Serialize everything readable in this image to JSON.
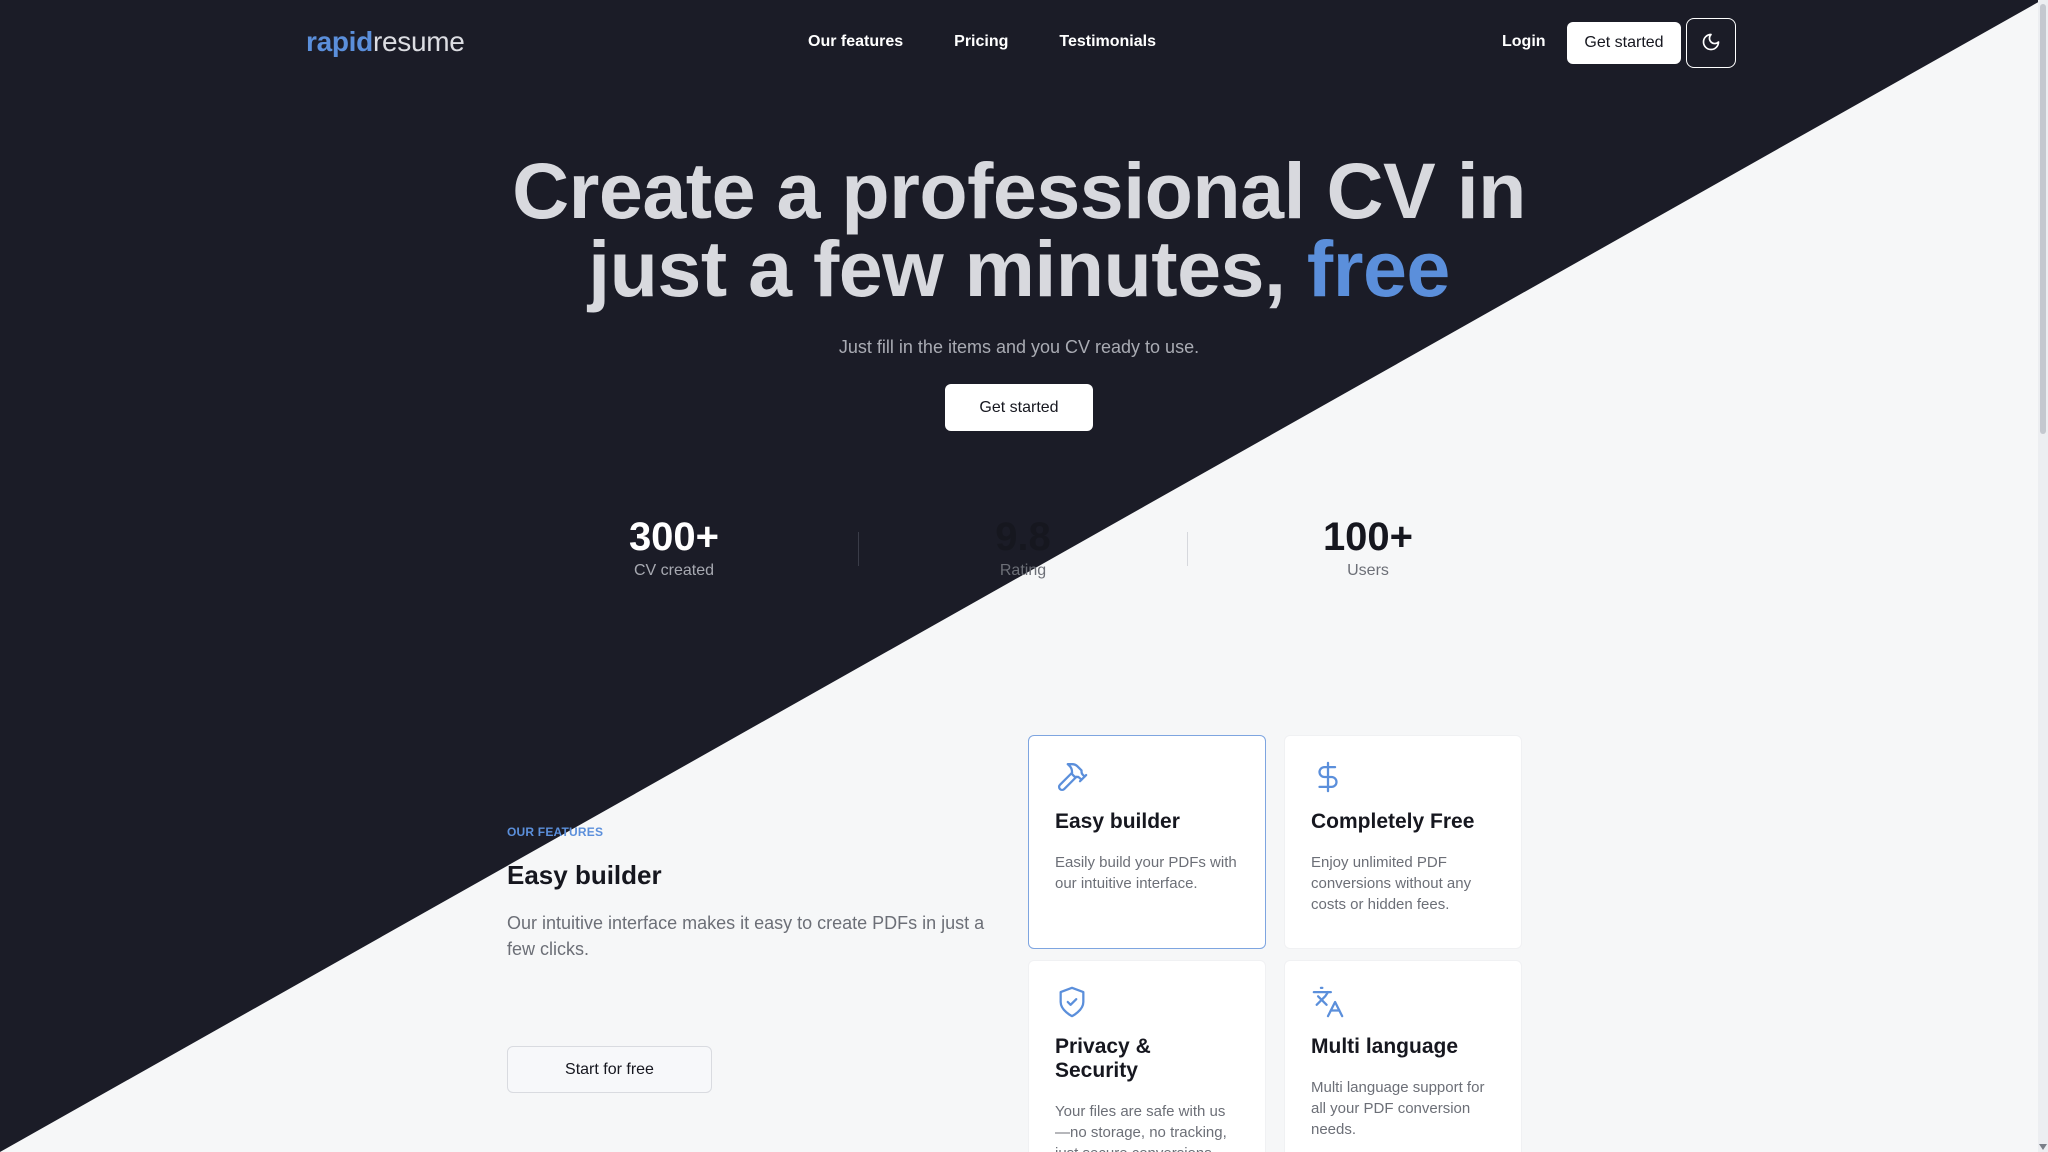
{
  "brand": {
    "prefix": "rapid",
    "suffix": "resume",
    "accent_color": "#5b8fdb"
  },
  "nav": {
    "links": [
      "Our features",
      "Pricing",
      "Testimonials"
    ],
    "login": "Login",
    "cta": "Get started",
    "theme_toggle_icon": "moon-icon"
  },
  "hero": {
    "title_line1": "Create a professional CV in",
    "title_line2_lead": "just a few minutes, ",
    "title_highlight": "free",
    "subtitle": "Just fill in the items and you CV ready to use.",
    "cta": "Get started"
  },
  "stats": [
    {
      "value": "300+",
      "label": "CV created"
    },
    {
      "value": "9.8",
      "label": "Rating"
    },
    {
      "value": "100+",
      "label": "Users"
    }
  ],
  "features": {
    "eyebrow": "OUR FEATURES",
    "heading": "Easy builder",
    "description": "Our intuitive interface makes it easy to create PDFs in just a few clicks.",
    "cta": "Start for free",
    "cards": [
      {
        "icon": "hammer-icon",
        "title": "Easy builder",
        "text": "Easily build your PDFs with our intuitive interface."
      },
      {
        "icon": "dollar-icon",
        "title": "Completely Free",
        "text": "Enjoy unlimited PDF conversions without any costs or hidden fees."
      },
      {
        "icon": "shield-check-icon",
        "title": "Privacy & Security",
        "text": "Your files are safe with us—no storage, no tracking, just secure conversions."
      },
      {
        "icon": "translate-icon",
        "title": "Multi language",
        "text": "Multi language support for all your PDF conversion needs."
      }
    ]
  },
  "colors": {
    "dark_bg": "#1b1c27",
    "light_bg": "#f6f7f8",
    "accent": "#5b8fdb"
  }
}
